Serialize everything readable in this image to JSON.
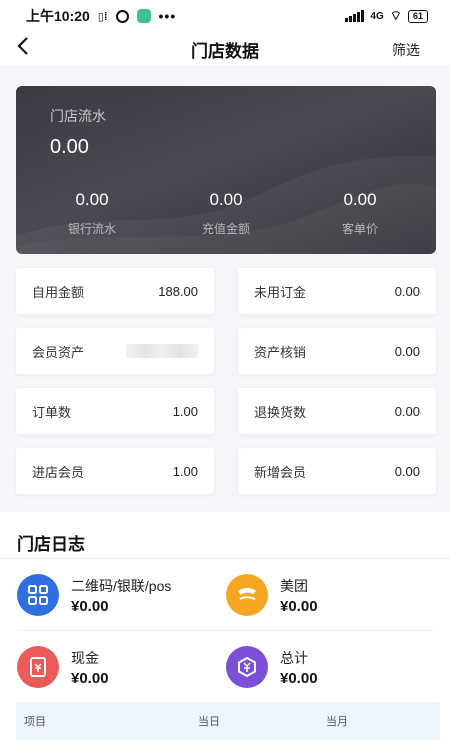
{
  "status_bar": {
    "time": "上午10:20",
    "network": "4G",
    "battery": "61"
  },
  "nav": {
    "title": "门店数据",
    "filter": "筛选"
  },
  "hero": {
    "label": "门店流水",
    "value": "0.00",
    "metrics": [
      {
        "value": "0.00",
        "label": "银行流水"
      },
      {
        "value": "0.00",
        "label": "充值金额"
      },
      {
        "value": "0.00",
        "label": "客单价"
      }
    ]
  },
  "stats": [
    {
      "label": "自用金额",
      "value": "188.00"
    },
    {
      "label": "未用订金",
      "value": "0.00"
    },
    {
      "label": "会员资产",
      "value": ""
    },
    {
      "label": "资产核销",
      "value": "0.00"
    },
    {
      "label": "订单数",
      "value": "1.00"
    },
    {
      "label": "退换货数",
      "value": "0.00"
    },
    {
      "label": "进店会员",
      "value": "1.00"
    },
    {
      "label": "新增会员",
      "value": "0.00"
    }
  ],
  "log": {
    "title": "门店日志",
    "payments": [
      {
        "label": "二维码/银联/pos",
        "value": "¥0.00",
        "icon": "qrcode-icon",
        "color": "#2f6fe0"
      },
      {
        "label": "美团",
        "value": "¥0.00",
        "icon": "meituan-icon",
        "color": "#f6a623"
      },
      {
        "label": "现金",
        "value": "¥0.00",
        "icon": "cash-icon",
        "color": "#ec5a5a"
      },
      {
        "label": "总计",
        "value": "¥0.00",
        "icon": "total-icon",
        "color": "#7b4fd6"
      }
    ],
    "table_headers": [
      "项目",
      "当日",
      "当月"
    ]
  }
}
